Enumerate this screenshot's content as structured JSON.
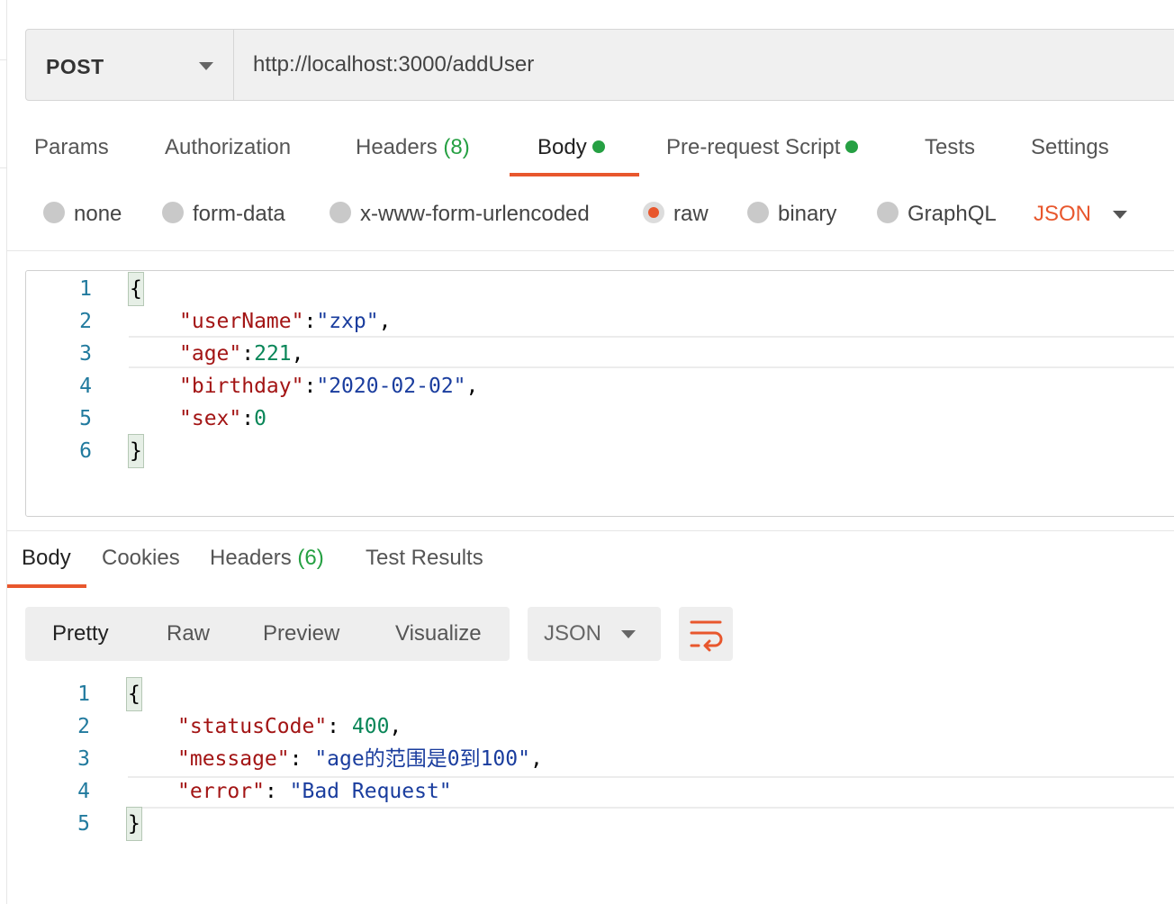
{
  "request": {
    "method": "POST",
    "url": "http://localhost:3000/addUser"
  },
  "request_tabs": {
    "params": "Params",
    "authorization": "Authorization",
    "headers": "Headers",
    "headers_count": "(8)",
    "body": "Body",
    "prerequest": "Pre-request Script",
    "tests": "Tests",
    "settings": "Settings",
    "active": "Body"
  },
  "body_types": {
    "none": "none",
    "form_data": "form-data",
    "urlencoded": "x-www-form-urlencoded",
    "raw": "raw",
    "binary": "binary",
    "graphql": "GraphQL",
    "selected": "raw",
    "format": "JSON"
  },
  "request_body": {
    "line_numbers": [
      "1",
      "2",
      "3",
      "4",
      "5",
      "6"
    ],
    "open": "{",
    "close": "}",
    "fields": [
      {
        "key": "\"userName\"",
        "sep": ":",
        "value": "\"zxp\"",
        "value_type": "string",
        "tail": ","
      },
      {
        "key": "\"age\"",
        "sep": ":",
        "value": "221",
        "value_type": "number",
        "tail": ","
      },
      {
        "key": "\"birthday\"",
        "sep": ":",
        "value": "\"2020-02-02\"",
        "value_type": "string",
        "tail": ","
      },
      {
        "key": "\"sex\"",
        "sep": ":",
        "value": "0",
        "value_type": "number",
        "tail": ""
      }
    ]
  },
  "response_tabs": {
    "body": "Body",
    "cookies": "Cookies",
    "headers": "Headers",
    "headers_count": "(6)",
    "test_results": "Test Results",
    "active": "Body"
  },
  "view_modes": {
    "pretty": "Pretty",
    "raw": "Raw",
    "preview": "Preview",
    "visualize": "Visualize",
    "active": "Pretty",
    "format": "JSON",
    "wrap_icon": "wrap-lines-icon"
  },
  "response_body": {
    "line_numbers": [
      "1",
      "2",
      "3",
      "4",
      "5"
    ],
    "open": "{",
    "close": "}",
    "fields": [
      {
        "key": "\"statusCode\"",
        "sep": ": ",
        "value": "400",
        "value_type": "number",
        "tail": ","
      },
      {
        "key": "\"message\"",
        "sep": ": ",
        "value": "\"age的范围是0到100\"",
        "value_type": "string",
        "tail": ","
      },
      {
        "key": "\"error\"",
        "sep": ": ",
        "value": "\"Bad Request\"",
        "value_type": "string",
        "tail": ""
      }
    ]
  },
  "colors": {
    "accent": "#e8572d",
    "count_green": "#26a043",
    "json_key": "#a31515",
    "json_string": "#1a3d9e",
    "json_number": "#098658",
    "line_number": "#217a9e"
  }
}
